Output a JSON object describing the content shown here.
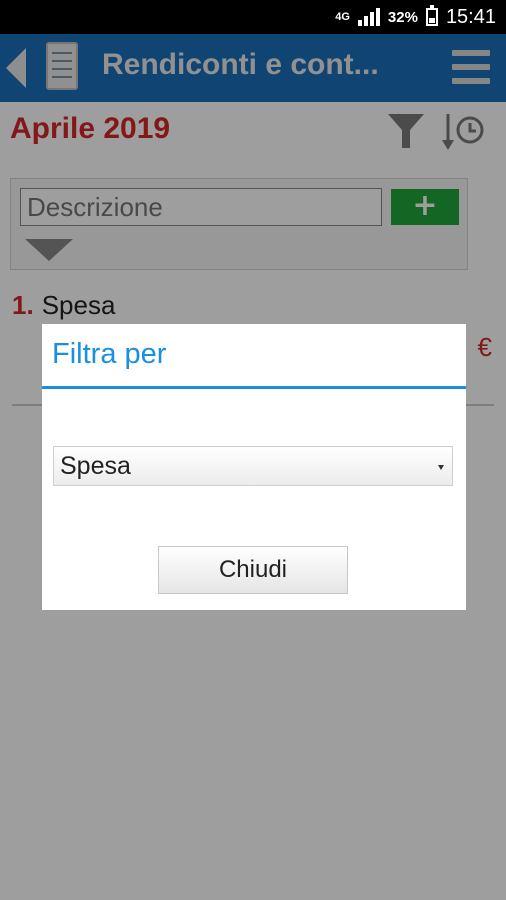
{
  "status_bar": {
    "network": "4G",
    "battery_percent": "32%",
    "time": "15:41"
  },
  "app_bar": {
    "title": "Rendiconti e cont..."
  },
  "main": {
    "month": "Aprile 2019",
    "description_placeholder": "Descrizione",
    "add_label": "+",
    "list": [
      {
        "number": "1.",
        "label": "Spesa",
        "amount": "€"
      }
    ]
  },
  "dialog": {
    "title": "Filtra per",
    "selected_value": "Spesa",
    "close_label": "Chiudi"
  },
  "colors": {
    "app_bar": "#1a6fb9",
    "accent_red": "#d32727",
    "dialog_accent": "#1a8fe0",
    "add_button": "#20a53a"
  }
}
